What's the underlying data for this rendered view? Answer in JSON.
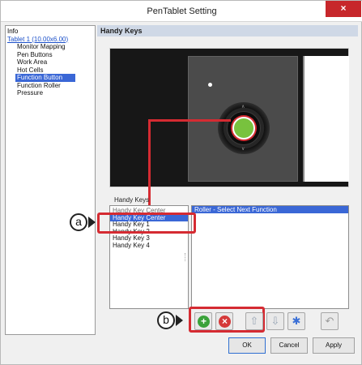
{
  "window": {
    "title": "PenTablet Setting",
    "close_glyph": "×"
  },
  "tree": {
    "items": [
      {
        "label": "Info"
      },
      {
        "label": "Tablet 1 (10.00x6.00)"
      },
      {
        "label": "Monitor Mapping"
      },
      {
        "label": "Pen Buttons"
      },
      {
        "label": "Work Area"
      },
      {
        "label": "Hot Cells"
      },
      {
        "label": "Function Button"
      },
      {
        "label": "Function Roller"
      },
      {
        "label": "Pressure"
      }
    ],
    "selected": "Function Button"
  },
  "pane": {
    "title": "Handy Keys"
  },
  "handy_keys": {
    "section_label": "Handy Keys",
    "items": [
      "Handy Key Center",
      "Handy Key Center",
      "Handy Key 1",
      "Handy Key 2",
      "Handy Key 3",
      "Handy Key 4"
    ],
    "selected_index": 1
  },
  "functions": {
    "items": [
      "Roller - Select Next Function"
    ]
  },
  "device": {
    "up_glyph": "∧",
    "down_glyph": "∨"
  },
  "callouts": {
    "a": "a",
    "b": "b"
  },
  "toolbar": {
    "add_glyph": "+",
    "remove_glyph": "×",
    "up_glyph": "⇧",
    "down_glyph": "⇩",
    "settings_glyph": "✱",
    "restore_glyph": "↶"
  },
  "buttons": {
    "ok": "OK",
    "cancel": "Cancel",
    "apply": "Apply"
  },
  "colors": {
    "accent": "#3a67d6",
    "highlight": "#d52b32",
    "center_button": "#78c23e",
    "add": "#3aa23a",
    "remove": "#d53a3a"
  }
}
